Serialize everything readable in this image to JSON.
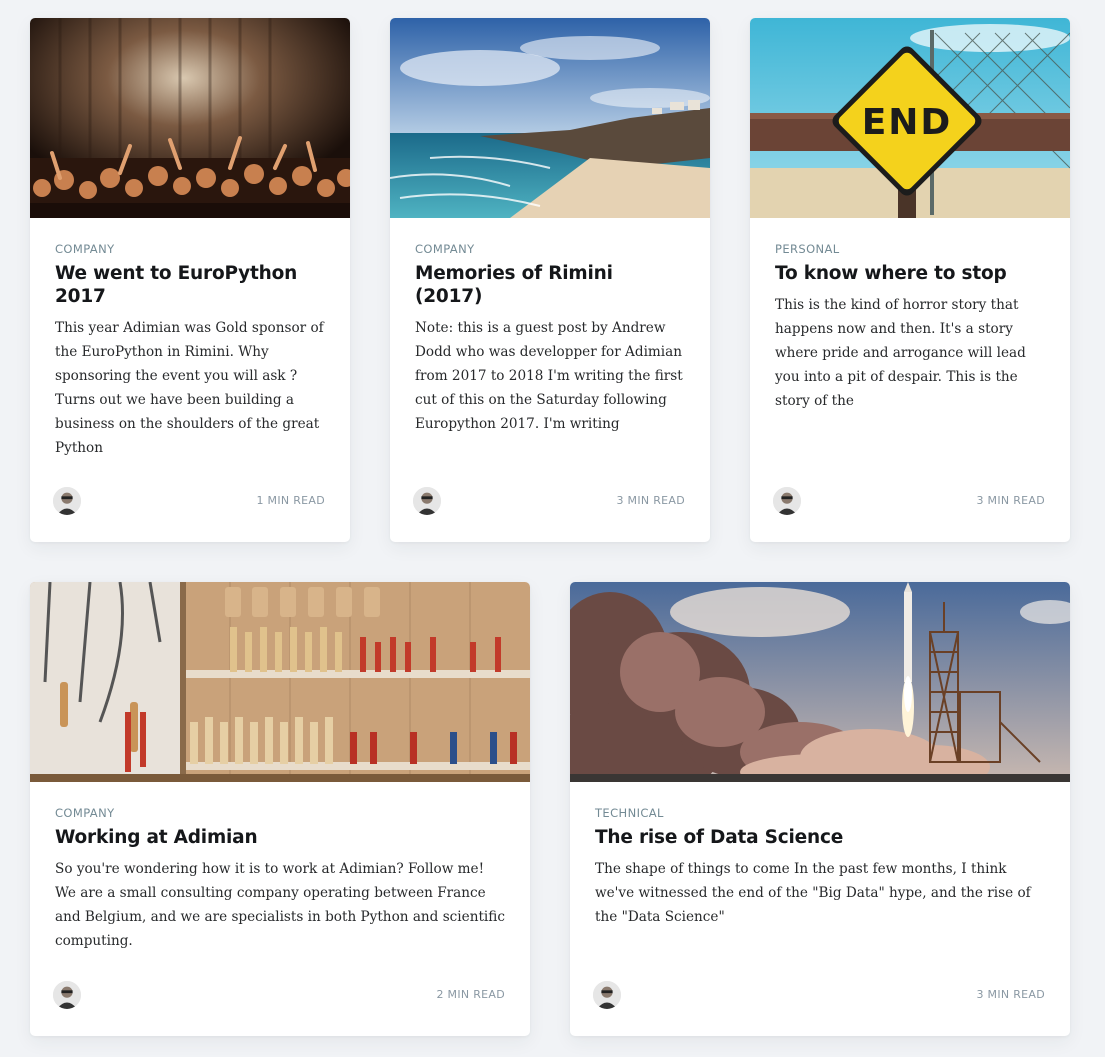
{
  "posts": [
    {
      "tag": "Company",
      "title": "We went to EuroPython 2017",
      "excerpt": "This year Adimian was Gold sponsor of the EuroPython in Rimini. Why sponsoring the event you will ask ? Turns out we have been building a business on the shoulders of the great Python",
      "read_time": "1 min read",
      "image": "concert-crowd-image"
    },
    {
      "tag": "Company",
      "title": "Memories of Rimini (2017)",
      "excerpt": "Note: this is a guest post by Andrew Dodd who was developper for Adimian from 2017 to 2018 I'm writing the first cut of this on the Saturday following Europython 2017. I'm writing",
      "read_time": "3 min read",
      "image": "beach-coast-image"
    },
    {
      "tag": "Personal",
      "title": "To know where to stop",
      "excerpt": "This is the kind of horror story that happens now and then. It's a story where pride and arrogance will lead you into a pit of despair. This is the story of the",
      "read_time": "3 min read",
      "image": "end-sign-image",
      "sign_text": "END"
    },
    {
      "tag": "Company",
      "title": "Working at Adimian",
      "excerpt": "So you're wondering how it is to work at Adimian? Follow me! We are a small consulting company operating between France and Belgium, and we are specialists in both Python and scientific computing.",
      "read_time": "2 min read",
      "image": "tool-wall-image"
    },
    {
      "tag": "Technical",
      "title": "The rise of Data Science",
      "excerpt": "The shape of things to come In the past few months, I think we've witnessed the end of the \"Big Data\" hype, and the rise of the \"Data Science\"",
      "read_time": "3 min read",
      "image": "rocket-launch-image"
    }
  ],
  "colors": {
    "background": "#f1f3f6",
    "tag": "#738a94",
    "title": "#15171a",
    "read_time": "#8a98a3"
  }
}
